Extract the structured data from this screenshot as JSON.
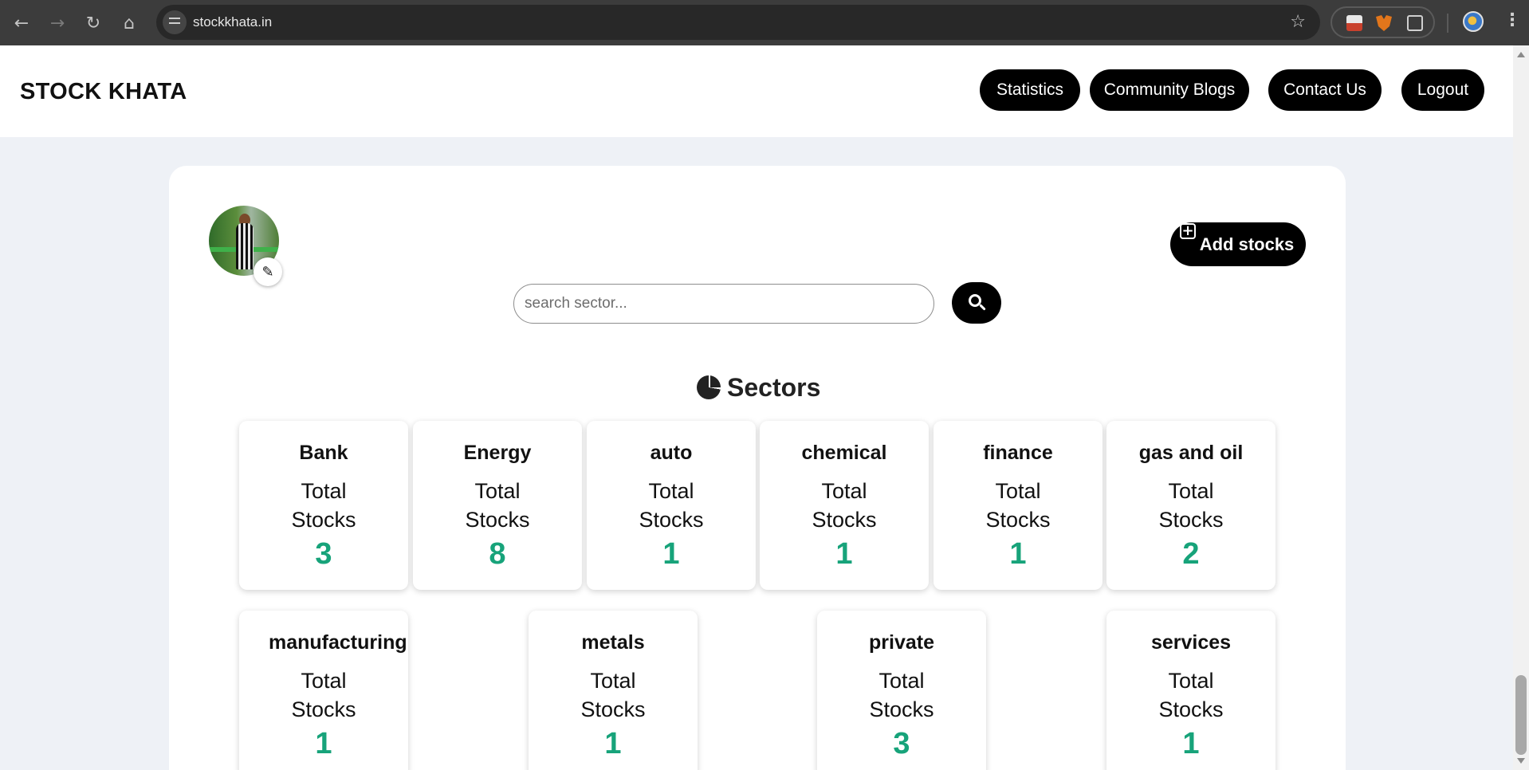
{
  "browser": {
    "url": "stockkhata.in"
  },
  "header": {
    "logo": "STOCK KHATA",
    "nav": [
      {
        "label": "Statistics"
      },
      {
        "label": "Community Blogs"
      },
      {
        "label": "Contact Us"
      },
      {
        "label": "Logout"
      }
    ]
  },
  "toolbar": {
    "add_stocks_label": "Add stocks"
  },
  "search": {
    "placeholder": "search sector..."
  },
  "sectors": {
    "title": "Sectors",
    "total_label_1": "Total",
    "total_label_2": "Stocks",
    "items": [
      {
        "name": "Bank",
        "count": "3"
      },
      {
        "name": "Energy",
        "count": "8"
      },
      {
        "name": "auto",
        "count": "1"
      },
      {
        "name": "chemical",
        "count": "1"
      },
      {
        "name": "finance",
        "count": "1"
      },
      {
        "name": "gas and oil",
        "count": "2"
      },
      {
        "name": "manufacturing",
        "count": "1"
      },
      {
        "name": "metals",
        "count": "1"
      },
      {
        "name": "private",
        "count": "3"
      },
      {
        "name": "services",
        "count": "1"
      }
    ]
  },
  "colors": {
    "accent_count": "#17a37a",
    "button_bg": "#000000",
    "page_bg": "#eef1f6"
  }
}
